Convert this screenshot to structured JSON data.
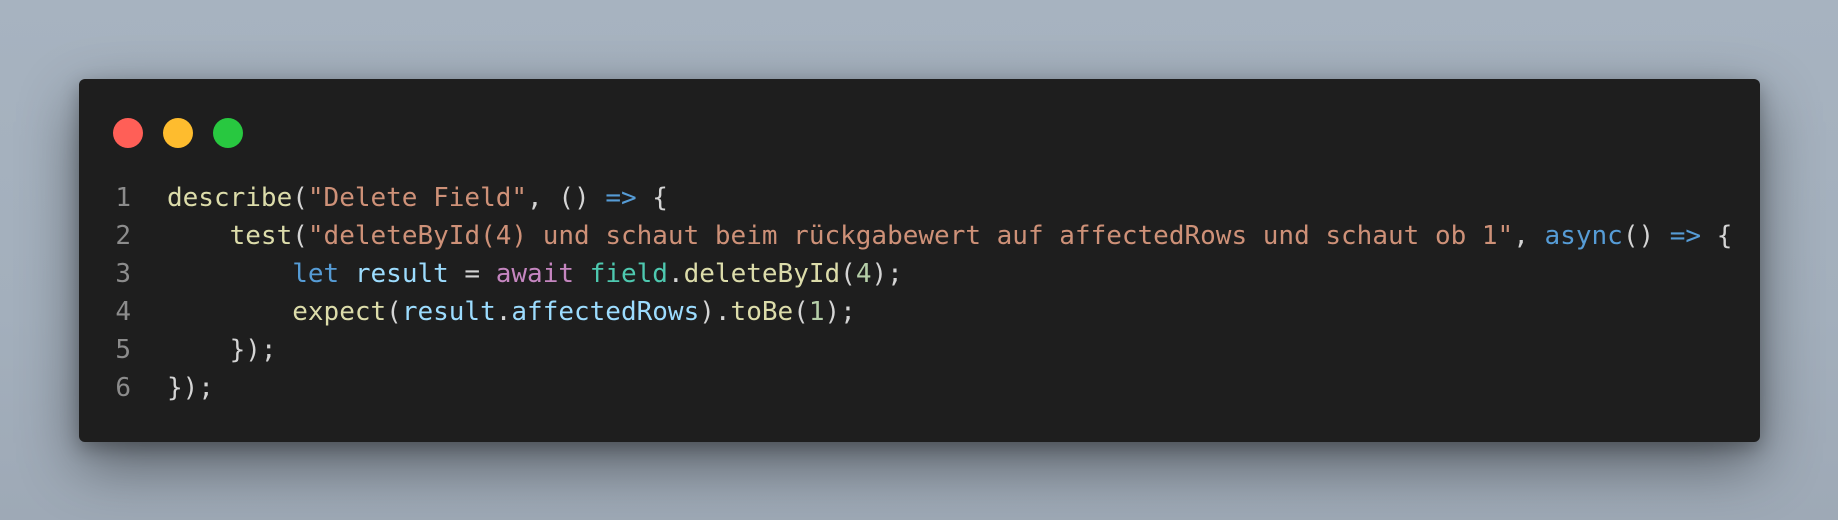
{
  "window": {
    "controls": [
      {
        "name": "close",
        "color": "#ff5f57"
      },
      {
        "name": "minimize",
        "color": "#febc2e"
      },
      {
        "name": "maximize",
        "color": "#28c840"
      }
    ]
  },
  "code": {
    "lines": [
      {
        "number": "1",
        "indent": "",
        "tokens": [
          {
            "text": "describe",
            "type": "fn"
          },
          {
            "text": "(",
            "type": "pun"
          },
          {
            "text": "\"Delete Field\"",
            "type": "str"
          },
          {
            "text": ", () ",
            "type": "pun"
          },
          {
            "text": "=>",
            "type": "kw"
          },
          {
            "text": " {",
            "type": "pun"
          }
        ]
      },
      {
        "number": "2",
        "indent": "    ",
        "tokens": [
          {
            "text": "test",
            "type": "fn"
          },
          {
            "text": "(",
            "type": "pun"
          },
          {
            "text": "\"deleteById(4) und schaut beim rückgabewert auf affectedRows und schaut ob 1\"",
            "type": "str"
          },
          {
            "text": ", ",
            "type": "pun"
          },
          {
            "text": "async",
            "type": "kw"
          },
          {
            "text": "() ",
            "type": "pun"
          },
          {
            "text": "=>",
            "type": "kw"
          },
          {
            "text": " {",
            "type": "pun"
          }
        ]
      },
      {
        "number": "3",
        "indent": "        ",
        "tokens": [
          {
            "text": "let",
            "type": "kw"
          },
          {
            "text": " ",
            "type": "pun"
          },
          {
            "text": "result",
            "type": "var"
          },
          {
            "text": " = ",
            "type": "pun"
          },
          {
            "text": "await",
            "type": "ctl"
          },
          {
            "text": " ",
            "type": "pun"
          },
          {
            "text": "field",
            "type": "obj"
          },
          {
            "text": ".",
            "type": "pun"
          },
          {
            "text": "deleteById",
            "type": "fn"
          },
          {
            "text": "(",
            "type": "pun"
          },
          {
            "text": "4",
            "type": "num"
          },
          {
            "text": ");",
            "type": "pun"
          }
        ]
      },
      {
        "number": "4",
        "indent": "        ",
        "tokens": [
          {
            "text": "expect",
            "type": "fn"
          },
          {
            "text": "(",
            "type": "pun"
          },
          {
            "text": "result",
            "type": "var"
          },
          {
            "text": ".",
            "type": "pun"
          },
          {
            "text": "affectedRows",
            "type": "var"
          },
          {
            "text": ").",
            "type": "pun"
          },
          {
            "text": "toBe",
            "type": "fn"
          },
          {
            "text": "(",
            "type": "pun"
          },
          {
            "text": "1",
            "type": "num"
          },
          {
            "text": ");",
            "type": "pun"
          }
        ]
      },
      {
        "number": "5",
        "indent": "    ",
        "tokens": [
          {
            "text": "});",
            "type": "pun"
          }
        ]
      },
      {
        "number": "6",
        "indent": "",
        "tokens": [
          {
            "text": "});",
            "type": "pun"
          }
        ]
      }
    ]
  }
}
